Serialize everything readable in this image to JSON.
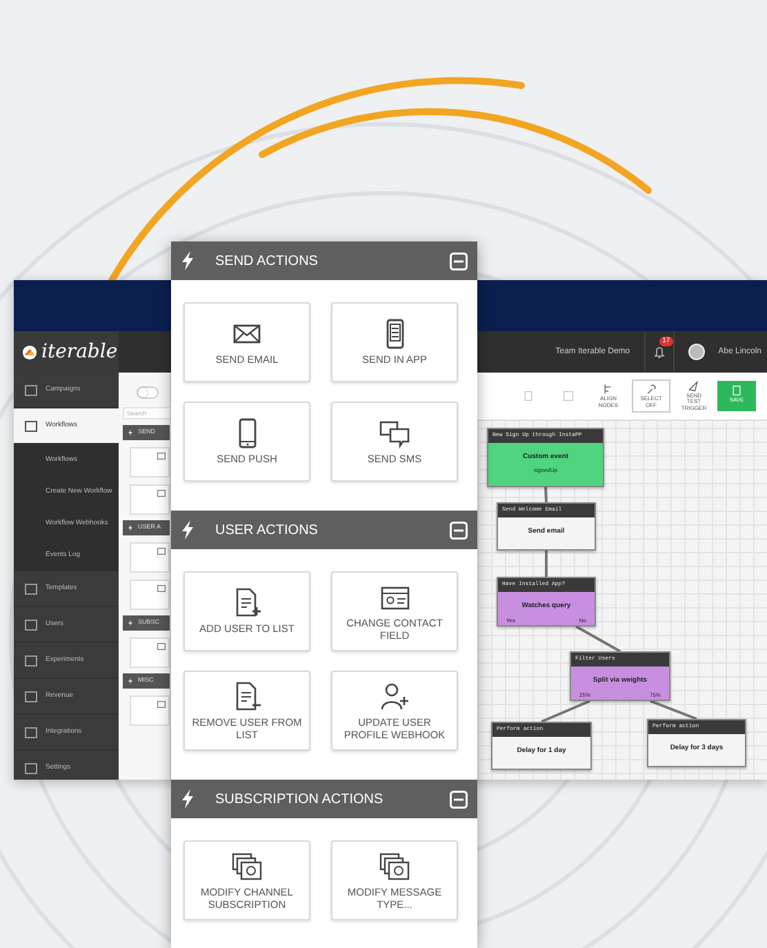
{
  "app": {
    "logo": "iterable",
    "team": "Team Iterable Demo",
    "notifications": "17",
    "user": "Abe Lincoln"
  },
  "sidebar": {
    "items": [
      {
        "label": "Campaigns",
        "selected": false
      },
      {
        "label": "Workflows",
        "selected": true,
        "children": [
          {
            "label": "Workflows"
          },
          {
            "label": "Create New Workflow"
          },
          {
            "label": "Workflow Webhooks"
          },
          {
            "label": "Events Log"
          }
        ]
      },
      {
        "label": "Templates",
        "selected": false
      },
      {
        "label": "Users",
        "selected": false
      },
      {
        "label": "Experiments",
        "selected": false
      },
      {
        "label": "Revenue",
        "selected": false
      },
      {
        "label": "Integrations",
        "selected": false
      },
      {
        "label": "Settings",
        "selected": false
      }
    ]
  },
  "palette": {
    "toggle_on": false,
    "search": {
      "placeholder": "Search"
    },
    "sections": [
      {
        "title": "SEND"
      },
      {
        "title": "USER A"
      },
      {
        "title": "SUBSC"
      },
      {
        "title": "MISC"
      }
    ]
  },
  "toolbar": [
    {
      "kind": "delete",
      "disabled": true
    },
    {
      "kind": "toggle",
      "disabled": true
    },
    {
      "kind": "align",
      "label": "ALIGN NODES",
      "disabled": false
    },
    {
      "kind": "select",
      "label": "SELECT OFF",
      "disabled": false
    },
    {
      "kind": "trigger",
      "label": "SEND TEST TRIGGER",
      "disabled": false
    },
    {
      "kind": "save",
      "label": "SAVE",
      "disabled": false
    }
  ],
  "workflow": {
    "nodes": [
      {
        "header": "New Sign Up through InstaPP",
        "title": "Custom event",
        "subtitle": "signedUp",
        "color": "#4fd47f"
      },
      {
        "header": "Send Welcome Email",
        "title": "Send email",
        "color": "#f4f4f4"
      },
      {
        "header": "Have Installed App?",
        "title": "Watches query",
        "color": "#c88fe0",
        "outputs": [
          "Yes",
          "No"
        ]
      },
      {
        "header": "Filter Users",
        "title": "Split via weights",
        "color": "#c88fe0",
        "outputs": [
          "25%",
          "75%"
        ]
      },
      {
        "header": "Perform action",
        "title": "Delay for 1 day",
        "color": "#f4f4f4"
      },
      {
        "header": "Perform action",
        "title": "Delay for 3 days",
        "color": "#f4f4f4"
      }
    ]
  },
  "panel": {
    "sections": [
      {
        "title": "SEND ACTIONS",
        "expanded": true,
        "items": [
          {
            "kind": "email",
            "label": "SEND EMAIL"
          },
          {
            "kind": "inapp",
            "label": "SEND IN APP"
          },
          {
            "kind": "push",
            "label": "SEND PUSH"
          },
          {
            "kind": "sms",
            "label": "SEND SMS"
          }
        ]
      },
      {
        "title": "USER ACTIONS",
        "expanded": true,
        "items": [
          {
            "kind": "addlist",
            "label": "ADD USER TO LIST"
          },
          {
            "kind": "field",
            "label": "CHANGE CONTACT FIELD"
          },
          {
            "kind": "removelist",
            "label": "REMOVE USER FROM LIST"
          },
          {
            "kind": "webhook",
            "label": "UPDATE USER PROFILE WEBHOOK"
          }
        ]
      },
      {
        "title": "SUBSCRIPTION ACTIONS",
        "expanded": true,
        "items": [
          {
            "kind": "subscription",
            "label": "MODIFY CHANNEL SUBSCRIPTION"
          },
          {
            "kind": "subscription",
            "label": "MODIFY MESSAGE TYPE..."
          }
        ]
      }
    ]
  }
}
